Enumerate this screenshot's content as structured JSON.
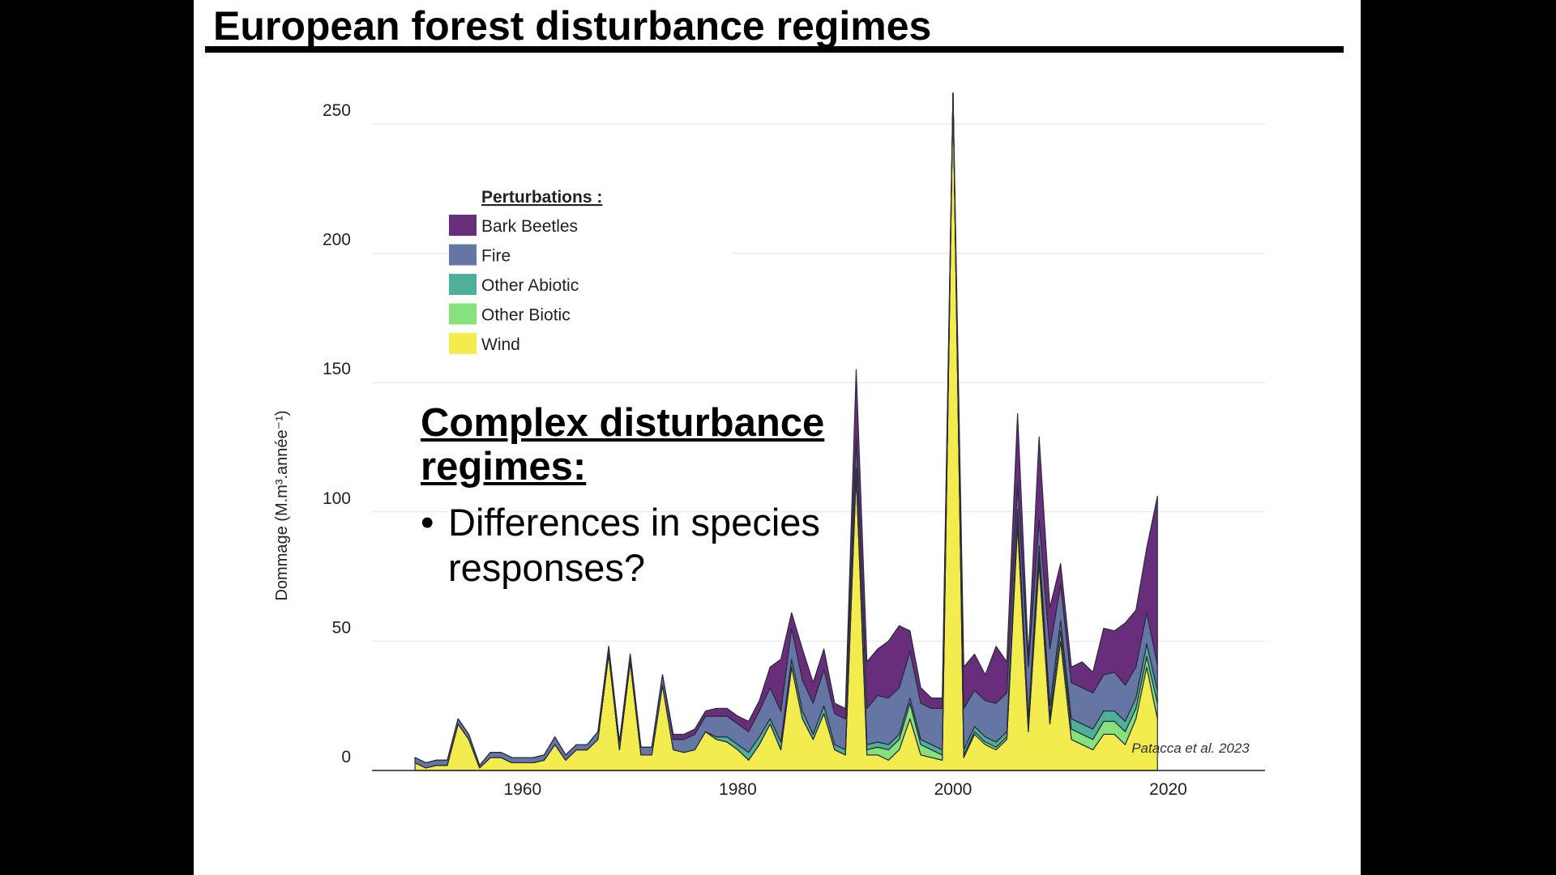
{
  "slide": {
    "title": "European forest disturbance regimes",
    "overlay_heading": "Complex disturbance regimes:",
    "overlay_bullet_marker": "•",
    "overlay_bullet": "Differences in species responses?"
  },
  "chart_data": {
    "type": "area",
    "stacked": true,
    "title": "",
    "ylabel": "Dommage (M.m³.année⁻¹)",
    "xlabel": "",
    "xlim": [
      1946,
      2029
    ],
    "ylim": [
      0,
      255
    ],
    "yticks": [
      0,
      50,
      100,
      150,
      200,
      250
    ],
    "xticks": [
      1960,
      1980,
      2000,
      2020
    ],
    "grid": "horizontal",
    "legend_title": "Perturbations :",
    "legend_position": "upper-left",
    "legend_order": [
      "Bark Beetles",
      "Fire",
      "Other Abiotic",
      "Other Biotic",
      "Wind"
    ],
    "annotation": "Patacca et al. 2023",
    "x": [
      1950,
      1951,
      1952,
      1953,
      1954,
      1955,
      1956,
      1957,
      1958,
      1959,
      1960,
      1961,
      1962,
      1963,
      1964,
      1965,
      1966,
      1967,
      1968,
      1969,
      1970,
      1971,
      1972,
      1973,
      1974,
      1975,
      1976,
      1977,
      1978,
      1979,
      1980,
      1981,
      1982,
      1983,
      1984,
      1985,
      1986,
      1987,
      1988,
      1989,
      1990,
      1991,
      1992,
      1993,
      1994,
      1995,
      1996,
      1997,
      1998,
      1999,
      2000,
      2001,
      2002,
      2003,
      2004,
      2005,
      2006,
      2007,
      2008,
      2009,
      2010,
      2011,
      2012,
      2013,
      2014,
      2015,
      2016,
      2017,
      2018,
      2019
    ],
    "series": [
      {
        "name": "Wind",
        "color": "#f2ec4e",
        "values": [
          3,
          1,
          2,
          2,
          18,
          12,
          1,
          5,
          5,
          3,
          3,
          3,
          4,
          10,
          4,
          8,
          8,
          12,
          45,
          8,
          42,
          6,
          6,
          33,
          8,
          7,
          8,
          15,
          12,
          11,
          8,
          4,
          10,
          18,
          8,
          40,
          20,
          12,
          22,
          8,
          6,
          115,
          6,
          6,
          4,
          8,
          20,
          6,
          5,
          4,
          262,
          5,
          14,
          10,
          8,
          12,
          95,
          15,
          80,
          18,
          50,
          12,
          10,
          8,
          14,
          14,
          10,
          20,
          40,
          20
        ]
      },
      {
        "name": "Other Biotic",
        "color": "#86e07b",
        "values": [
          0,
          0,
          0,
          0,
          0,
          0,
          0,
          0,
          0,
          0,
          0,
          0,
          0,
          0,
          0,
          0,
          0,
          0,
          0,
          0,
          0,
          0,
          0,
          0,
          0,
          0,
          0,
          0,
          0,
          0,
          0,
          0,
          0,
          0,
          0,
          0,
          0,
          0,
          0,
          0,
          0,
          0,
          2,
          3,
          4,
          4,
          6,
          4,
          3,
          2,
          0,
          1,
          1,
          1,
          1,
          1,
          3,
          2,
          4,
          3,
          4,
          4,
          4,
          4,
          5,
          5,
          5,
          4,
          4,
          6
        ]
      },
      {
        "name": "Other Abiotic",
        "color": "#4fb09a",
        "values": [
          0,
          0,
          0,
          0,
          0,
          0,
          0,
          0,
          0,
          0,
          0,
          0,
          0,
          0,
          0,
          0,
          0,
          0,
          0,
          0,
          0,
          0,
          0,
          0,
          0,
          0,
          0,
          0,
          1,
          2,
          2,
          3,
          3,
          2,
          3,
          3,
          3,
          2,
          3,
          2,
          2,
          2,
          2,
          2,
          2,
          2,
          2,
          2,
          2,
          2,
          0,
          2,
          2,
          2,
          2,
          2,
          3,
          3,
          3,
          4,
          4,
          4,
          4,
          4,
          4,
          4,
          4,
          4,
          5,
          5
        ]
      },
      {
        "name": "Fire",
        "color": "#6575a4",
        "values": [
          2,
          2,
          2,
          2,
          2,
          2,
          1,
          2,
          2,
          2,
          2,
          2,
          2,
          3,
          2,
          2,
          2,
          3,
          3,
          3,
          3,
          3,
          3,
          4,
          4,
          5,
          6,
          6,
          8,
          8,
          8,
          8,
          10,
          12,
          12,
          12,
          12,
          12,
          14,
          12,
          12,
          12,
          14,
          18,
          18,
          18,
          18,
          14,
          14,
          16,
          0,
          16,
          14,
          14,
          15,
          15,
          10,
          20,
          10,
          22,
          14,
          14,
          14,
          14,
          14,
          15,
          14,
          12,
          12,
          10
        ]
      },
      {
        "name": "Bark Beetles",
        "color": "#682e7b",
        "values": [
          0,
          0,
          0,
          0,
          0,
          0,
          0,
          0,
          0,
          0,
          0,
          0,
          0,
          0,
          0,
          0,
          0,
          0,
          0,
          0,
          0,
          0,
          0,
          0,
          2,
          2,
          2,
          2,
          3,
          3,
          3,
          4,
          4,
          8,
          20,
          6,
          12,
          8,
          8,
          4,
          4,
          26,
          18,
          18,
          22,
          24,
          8,
          6,
          4,
          4,
          0,
          16,
          14,
          10,
          22,
          12,
          27,
          4,
          32,
          16,
          8,
          6,
          10,
          8,
          18,
          16,
          24,
          22,
          25,
          65
        ]
      }
    ]
  }
}
